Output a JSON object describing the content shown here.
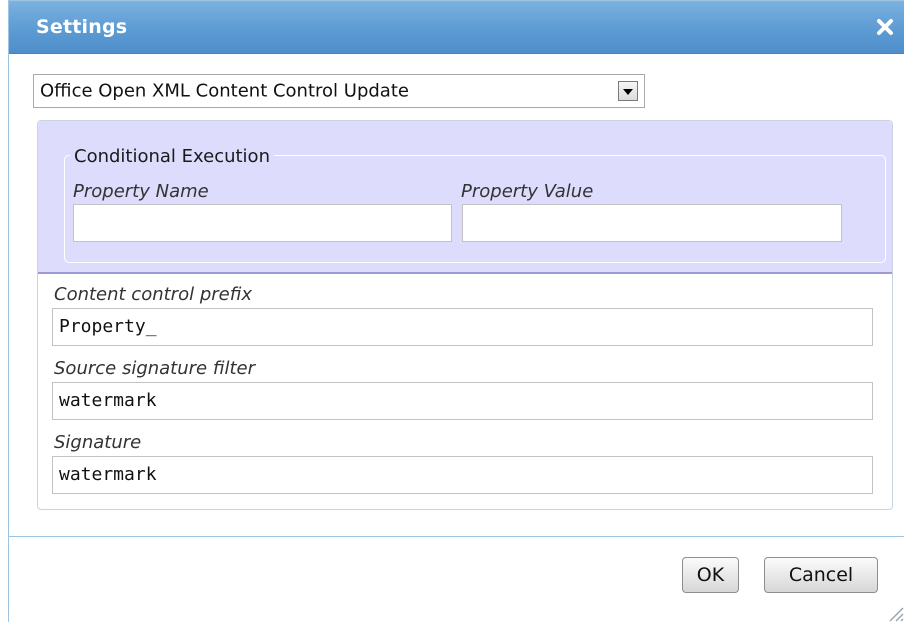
{
  "dialog": {
    "title": "Settings"
  },
  "type_select": {
    "value": "Office Open XML Content Control Update"
  },
  "conditional_execution": {
    "legend": "Conditional Execution",
    "property_name_label": "Property Name",
    "property_name_value": "",
    "property_value_label": "Property Value",
    "property_value_value": ""
  },
  "fields": {
    "content_control_prefix_label": "Content control prefix",
    "content_control_prefix_value": "Property_",
    "source_signature_filter_label": "Source signature filter",
    "source_signature_filter_value": "watermark",
    "signature_label": "Signature",
    "signature_value": "watermark"
  },
  "buttons": {
    "ok": "OK",
    "cancel": "Cancel"
  },
  "colors": {
    "titlebar": "#5d9bd3",
    "conditional_background": "#dddcfd",
    "conditional_border": "#9c9bd7"
  }
}
